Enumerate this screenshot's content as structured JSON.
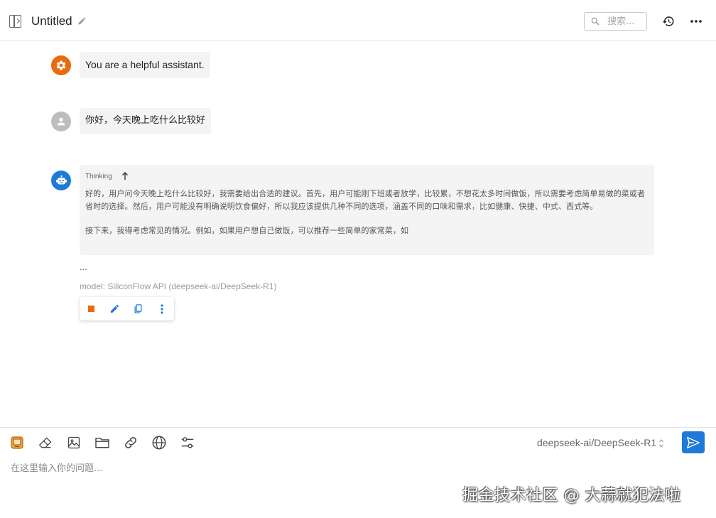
{
  "header": {
    "title": "Untitled",
    "search_placeholder": "搜索..."
  },
  "messages": {
    "system_text": "You are a helpful assistant.",
    "user_text": "你好，今天晚上吃什么比较好",
    "assistant": {
      "thinking_label": "Thinking",
      "thinking_paragraph_1": "好的，用户问今天晚上吃什么比较好，我需要给出合适的建议。首先，用户可能刚下班或者放学，比较累，不想花太多时间做饭，所以需要考虑简单易做的菜或者省时的选择。然后，用户可能没有明确说明饮食偏好，所以我应该提供几种不同的选项，涵盖不同的口味和需求，比如健康、快捷、中式、西式等。",
      "thinking_paragraph_2": "接下来，我得考虑常见的情况。例如，如果用户想自己做饭，可以推荐一些简单的家常菜，如",
      "ellipsis": "...",
      "model_info": "model: SiliconFlow API (deepseek-ai/DeepSeek-R1)"
    }
  },
  "composer": {
    "model_selected": "deepseek-ai/DeepSeek-R1",
    "input_placeholder": "在这里输入你的问题..."
  },
  "watermark": "掘金技术社区 @ 大蒜就犯法啦",
  "colors": {
    "accent": "#1e7ad6",
    "system_avatar": "#e96b10",
    "user_avatar": "#bdbdbd",
    "stop": "#e96b10"
  }
}
